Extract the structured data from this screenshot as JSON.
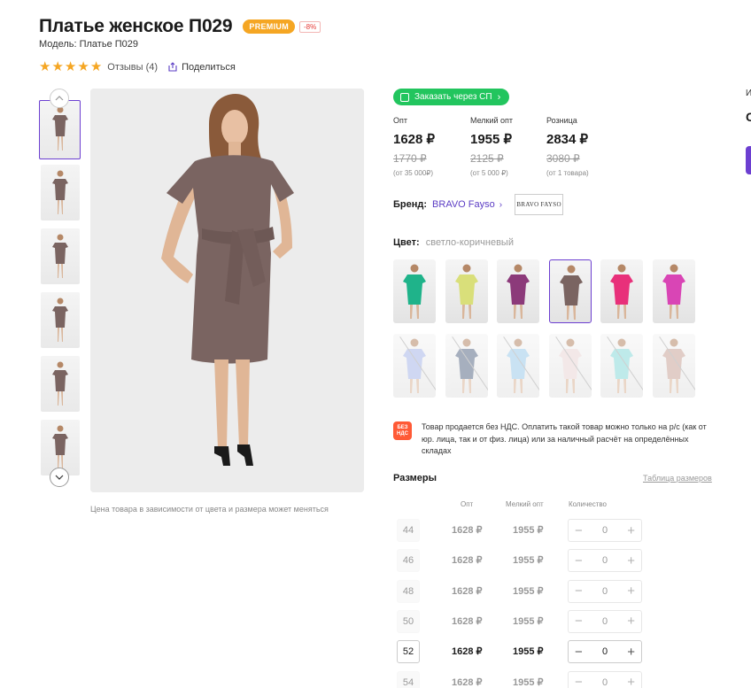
{
  "product": {
    "title": "Платье женское П029",
    "premium_badge": "PREMIUM",
    "discount_badge": "-8%",
    "model": "Модель: Платье П029",
    "rating_stars": 5,
    "reviews": "Отзывы (4)",
    "share": "Поделиться"
  },
  "gallery": {
    "note": "Цена товара в зависимости от цвета и размера может меняться",
    "dress_color": "#7a6461",
    "thumb_count": 6,
    "active_thumb": 0
  },
  "order_button": {
    "label": "Заказать через СП"
  },
  "prices": [
    {
      "label": "Опт",
      "price": "1628 ₽",
      "old": "1770 ₽",
      "from": "(от 35 000₽)"
    },
    {
      "label": "Мелкий опт",
      "price": "1955 ₽",
      "old": "2125 ₽",
      "from": "(от 5 000 ₽)"
    },
    {
      "label": "Розница",
      "price": "2834 ₽",
      "old": "3080 ₽",
      "from": "(от 1 товара)"
    }
  ],
  "brand": {
    "label": "Бренд:",
    "name": "BRAVO Fayso",
    "logo_text": "BRAVO FAYSO"
  },
  "color": {
    "label": "Цвет:",
    "value": "светло-коричневый",
    "swatches": [
      {
        "color": "#1fb38a",
        "available": true
      },
      {
        "color": "#d9df7a",
        "available": true
      },
      {
        "color": "#8c3a7a",
        "available": true
      },
      {
        "color": "#7a6461",
        "available": true,
        "selected": true
      },
      {
        "color": "#e8307a",
        "available": true
      },
      {
        "color": "#d945b5",
        "available": true
      },
      {
        "color": "#a9b8e8",
        "available": false
      },
      {
        "color": "#5f6f8a",
        "available": false
      },
      {
        "color": "#9ecbea",
        "available": false
      },
      {
        "color": "#ead6d6",
        "available": false
      },
      {
        "color": "#8ad9d9",
        "available": false
      },
      {
        "color": "#c9a59a",
        "available": false
      }
    ]
  },
  "notice": {
    "icon_text": "БЕЗ НДС",
    "text": "Товар продается без НДС. Оплатить такой товар можно только на р/с (как от юр. лица, так и от физ. лица) или за наличный расчёт на определённых складах"
  },
  "sizes": {
    "title": "Размеры",
    "table_link": "Таблица размеров",
    "headers": {
      "opt": "Опт",
      "small_opt": "Мелкий опт",
      "qty": "Количество"
    },
    "rows": [
      {
        "size": "44",
        "opt": "1628 ₽",
        "small_opt": "1955 ₽",
        "qty": "0",
        "available": false
      },
      {
        "size": "46",
        "opt": "1628 ₽",
        "small_opt": "1955 ₽",
        "qty": "0",
        "available": false
      },
      {
        "size": "48",
        "opt": "1628 ₽",
        "small_opt": "1955 ₽",
        "qty": "0",
        "available": false
      },
      {
        "size": "50",
        "opt": "1628 ₽",
        "small_opt": "1955 ₽",
        "qty": "0",
        "available": false
      },
      {
        "size": "52",
        "opt": "1628 ₽",
        "small_opt": "1955 ₽",
        "qty": "0",
        "available": true
      },
      {
        "size": "54",
        "opt": "1628 ₽",
        "small_opt": "1955 ₽",
        "qty": "0",
        "available": false
      }
    ]
  },
  "side_panel": {
    "label": "И",
    "value": "С"
  },
  "colors": {
    "accent": "#6c3fd1",
    "green": "#22c55e",
    "star": "#f5a623"
  }
}
